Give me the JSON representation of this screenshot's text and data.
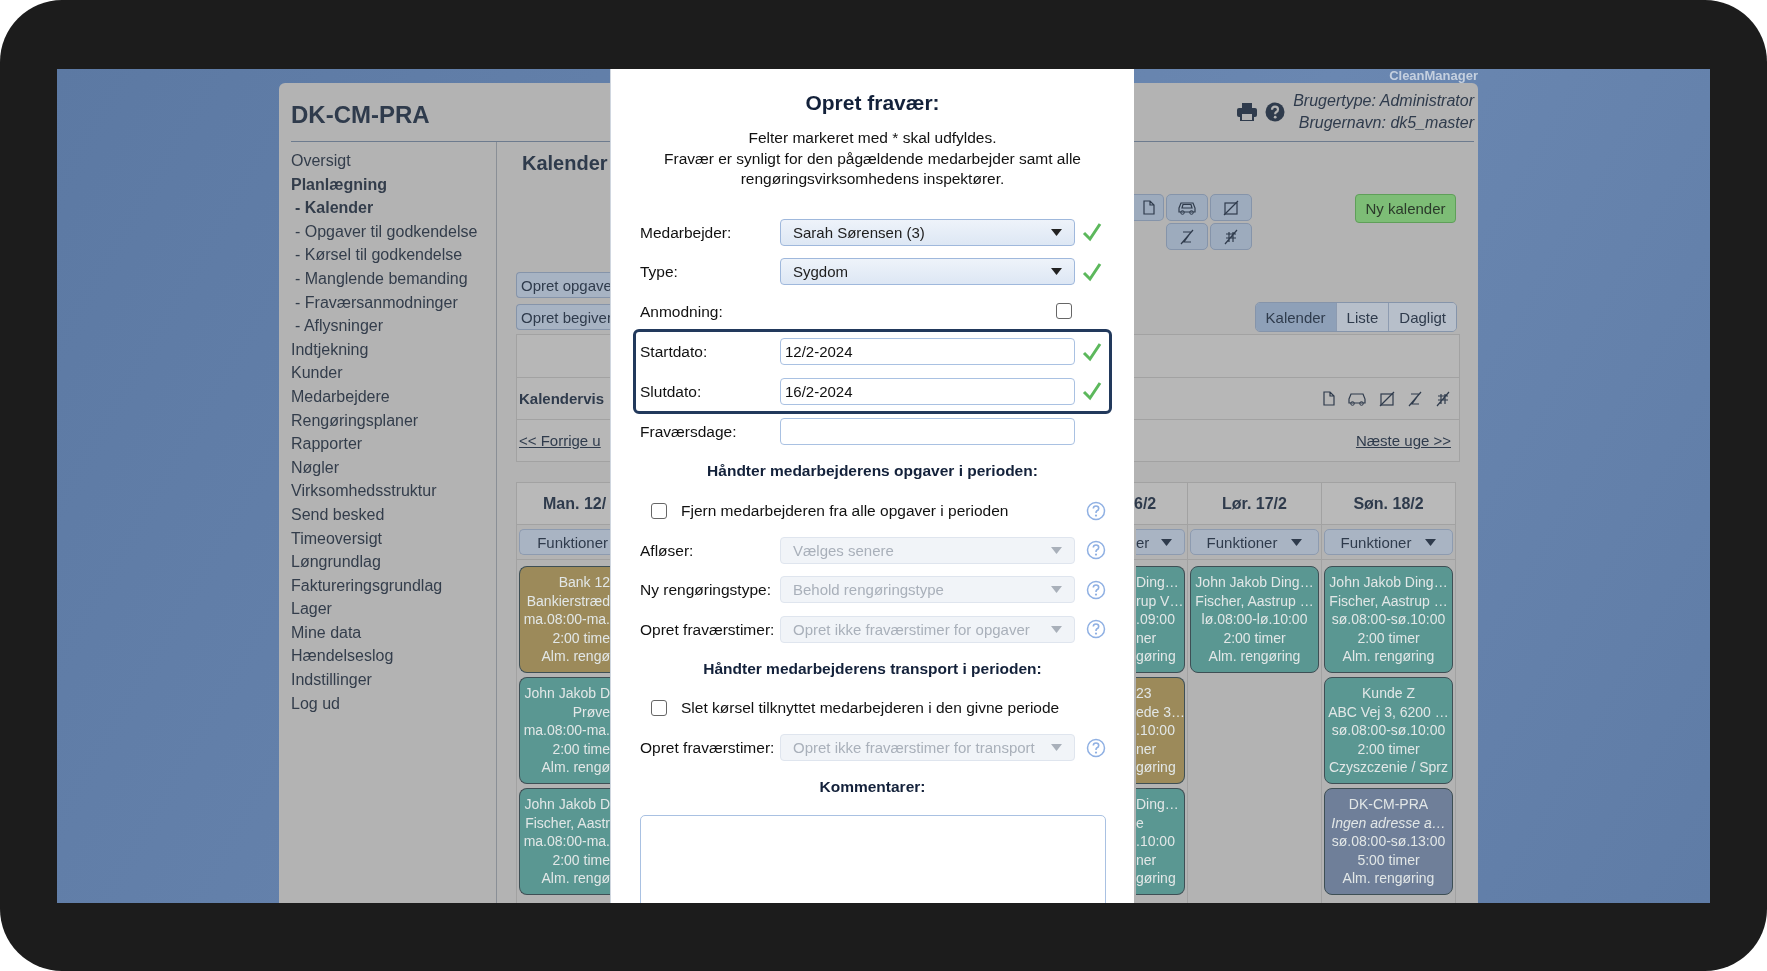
{
  "brand": "CleanManager",
  "header": {
    "title": "DK-CM-PRA",
    "user_type": "Brugertype: Administrator",
    "user_name": "Brugernavn: dk5_master"
  },
  "sidebar": {
    "items": [
      {
        "label": "Oversigt",
        "selected": false
      },
      {
        "label": "Planlægning",
        "expanded": true,
        "children": [
          {
            "label": "- Kalender",
            "selected": true
          },
          {
            "label": "- Opgaver til godkendelse",
            "selected": false
          },
          {
            "label": "- Kørsel til godkendelse",
            "selected": false
          },
          {
            "label": "- Manglende bemanding",
            "selected": false
          },
          {
            "label": "- Fraværsanmodninger",
            "selected": false
          },
          {
            "label": "- Aflysninger",
            "selected": false
          }
        ]
      },
      {
        "label": "Indtjekning",
        "selected": false
      },
      {
        "label": "Kunder",
        "selected": false
      },
      {
        "label": "Medarbejdere",
        "selected": false
      },
      {
        "label": "Rengøringsplaner",
        "selected": false
      },
      {
        "label": "Rapporter",
        "selected": false
      },
      {
        "label": "Nøgler",
        "selected": false
      },
      {
        "label": "Virksomhedsstruktur",
        "selected": false
      },
      {
        "label": "Send besked",
        "selected": false
      },
      {
        "label": "Timeoversigt",
        "selected": false
      },
      {
        "label": "Løngrundlag",
        "selected": false
      },
      {
        "label": "Faktureringsgrundlag",
        "selected": false
      },
      {
        "label": "Lager",
        "selected": false
      },
      {
        "label": "Mine data",
        "selected": false
      },
      {
        "label": "Hændelseslog",
        "selected": false
      },
      {
        "label": "Indstillinger",
        "selected": false
      },
      {
        "label": "Log ud",
        "selected": false
      }
    ]
  },
  "main": {
    "title": "Kalender",
    "create_buttons": [
      "Opret opgave",
      "Opret begiver"
    ],
    "new_calendar": "Ny kalender",
    "view_tabs": [
      {
        "label": "Kalender",
        "selected": true
      },
      {
        "label": "Liste",
        "selected": false
      },
      {
        "label": "Dagligt",
        "selected": false
      }
    ],
    "calendar_view_label": "Kalendervis",
    "prev_week": "<< Forrige u",
    "next_week": "Næste uge >>"
  },
  "calendar": {
    "days": [
      {
        "header": "Man. 12/",
        "functions": "Funktioner",
        "events": [
          {
            "color": "#9c8a5a",
            "title": "Bank 12",
            "address": "Bankierstræd",
            "time": "ma.08:00-ma.",
            "duration": "2:00 time",
            "type": "Alm. rengø",
            "address_missing": false
          },
          {
            "color": "#5a9792",
            "title": "John Jakob D",
            "address": "Prøve",
            "time": "ma.08:00-ma.",
            "duration": "2:00 time",
            "type": "Alm. rengø",
            "address_missing": false
          },
          {
            "color": "#5a9792",
            "title": "John Jakob D",
            "address": "Fischer, Aastr",
            "time": "ma.08:00-ma.",
            "duration": "2:00 time",
            "type": "Alm. rengø",
            "address_missing": false
          }
        ]
      },
      {
        "header": "6/2",
        "functions": "er",
        "events": [
          {
            "color": "#5a9792",
            "title": "Ding…",
            "address": "rup V…",
            "time": ".09:00",
            "duration": "ner",
            "type": "gøring",
            "address_missing": false
          },
          {
            "color": "#9c8a5a",
            "title": "23",
            "address": "ede 3…",
            "time": ".10:00",
            "duration": "ner",
            "type": "gøring",
            "address_missing": false
          },
          {
            "color": "#5a9792",
            "title": "Ding…",
            "address": "e",
            "time": ".10:00",
            "duration": "ner",
            "type": "gøring",
            "address_missing": false
          }
        ]
      },
      {
        "header": "Lør. 17/2",
        "functions": "Funktioner",
        "events": [
          {
            "color": "#5a9792",
            "title": "John Jakob Ding…",
            "address": "Fischer, Aastrup …",
            "time": "lø.08:00-lø.10:00",
            "duration": "2:00 timer",
            "type": "Alm. rengøring",
            "address_missing": false
          }
        ]
      },
      {
        "header": "Søn. 18/2",
        "functions": "Funktioner",
        "events": [
          {
            "color": "#5a9792",
            "title": "John Jakob Ding…",
            "address": "Fischer, Aastrup …",
            "time": "sø.08:00-sø.10:00",
            "duration": "2:00 timer",
            "type": "Alm. rengøring",
            "address_missing": false
          },
          {
            "color": "#5a9792",
            "title": "Kunde Z",
            "address": "ABC Vej 3, 6200 …",
            "time": "sø.08:00-sø.10:00",
            "duration": "2:00 timer",
            "type": "Czyszczenie / Sprz",
            "address_missing": false
          },
          {
            "color": "#6f7f99",
            "title": "DK-CM-PRA",
            "address": "Ingen adresse a…",
            "time": "sø.08:00-sø.13:00",
            "duration": "5:00 timer",
            "type": "Alm. rengøring",
            "address_missing": true
          }
        ]
      }
    ]
  },
  "dialog": {
    "title": "Opret fravær:",
    "notes": [
      "Felter markeret med * skal udfyldes.",
      "Fravær er synligt for den pågældende medarbejder samt alle rengøringsvirksomhedens inspektører."
    ],
    "rows": [
      {
        "kind": "select",
        "label": "Medarbejder:",
        "value": "Sarah Sørensen (3)",
        "valid": true,
        "disabled": false
      },
      {
        "kind": "select",
        "label": "Type:",
        "value": "Sygdom",
        "valid": true,
        "disabled": false
      },
      {
        "kind": "checkbox",
        "label": "Anmodning:",
        "checked": false
      },
      {
        "kind": "text",
        "label": "Startdato:",
        "value": "12/2-2024",
        "valid": true,
        "highlighted": true
      },
      {
        "kind": "text",
        "label": "Slutdato:",
        "value": "16/2-2024",
        "valid": true,
        "highlighted": true
      },
      {
        "kind": "text",
        "label": "Fraværsdage:"
      },
      {
        "kind": "heading",
        "text": "Håndter medarbejderens opgaver i perioden:"
      },
      {
        "kind": "option",
        "text": "Fjern medarbejderen fra alle opgaver i perioden",
        "checked": false,
        "help": true
      },
      {
        "kind": "select",
        "label": "Afløser:",
        "value": "Vælges senere",
        "disabled": true,
        "help": true
      },
      {
        "kind": "select",
        "label": "Ny rengøringstype:",
        "value": "Behold rengøringstype",
        "disabled": true,
        "help": true
      },
      {
        "kind": "select",
        "label": "Opret fraværstimer:",
        "value": "Opret ikke fraværstimer for opgaver",
        "disabled": true,
        "help": true
      },
      {
        "kind": "heading",
        "text": "Håndter medarbejderens transport i perioden:"
      },
      {
        "kind": "option",
        "text": "Slet kørsel tilknyttet medarbejderen i den givne periode",
        "checked": false,
        "help": false
      },
      {
        "kind": "select",
        "label": "Opret fraværstimer:",
        "value": "Opret ikke fraværstimer for transport",
        "disabled": true,
        "help": true
      },
      {
        "kind": "heading",
        "text": "Kommentarer:"
      },
      {
        "kind": "textarea"
      }
    ]
  }
}
